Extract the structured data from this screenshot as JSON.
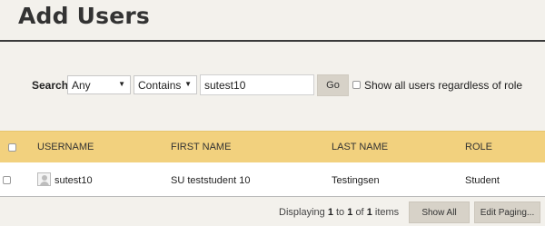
{
  "page": {
    "title": "Add Users"
  },
  "search": {
    "label": "Search:",
    "field_option": "Any",
    "operator_option": "Contains",
    "query_value": "sutest10",
    "go_label": "Go",
    "show_all_label": "Show all users regardless of role"
  },
  "table": {
    "columns": [
      "USERNAME",
      "FIRST NAME",
      "LAST NAME",
      "ROLE"
    ],
    "rows": [
      {
        "username": "sutest10",
        "first_name": "SU teststudent 10",
        "last_name": "Testingsen",
        "role": "Student"
      }
    ]
  },
  "footer": {
    "displaying": "Displaying",
    "start": "1",
    "to": "to",
    "end": "1",
    "of": "of",
    "total": "1",
    "items": "items",
    "show_all_label": "Show All",
    "edit_paging_label": "Edit Paging..."
  },
  "icons": {
    "dropdown_arrow": "▼"
  }
}
